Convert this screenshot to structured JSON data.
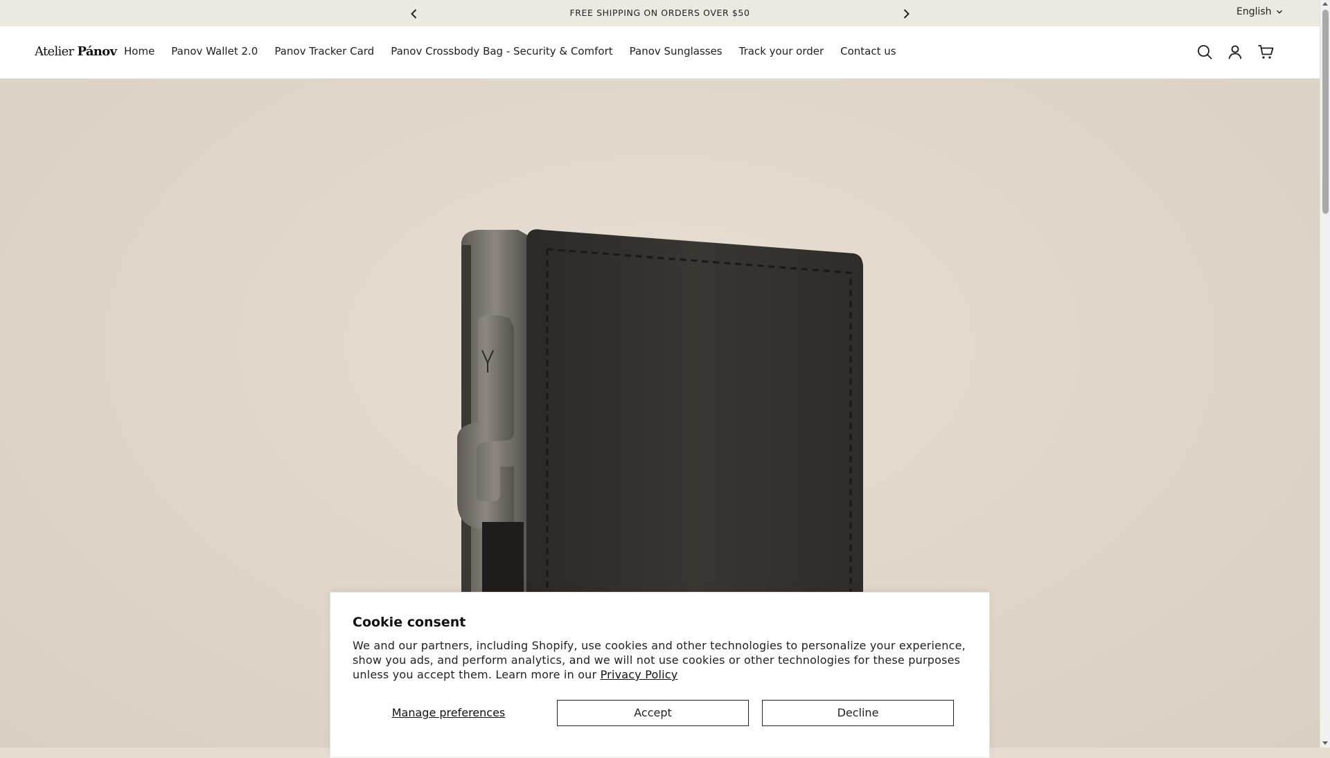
{
  "announcement": {
    "text": "FREE SHIPPING ON ORDERS OVER $50",
    "language": "English",
    "prev_icon": "chevron-left-icon",
    "next_icon": "chevron-right-icon"
  },
  "header": {
    "logo_light": "Atelier ",
    "logo_bold": "Pánov",
    "nav": [
      {
        "label": "Home"
      },
      {
        "label": "Panov Wallet 2.0"
      },
      {
        "label": "Panov Tracker Card"
      },
      {
        "label": "Panov Crossbody Bag - Security & Comfort"
      },
      {
        "label": "Panov Sunglasses"
      },
      {
        "label": "Track your order"
      },
      {
        "label": "Contact us"
      }
    ],
    "icons": [
      "search-icon",
      "account-icon",
      "cart-icon"
    ]
  },
  "cookie": {
    "title": "Cookie consent",
    "body": "We and our partners, including Shopify, use cookies and other technologies to personalize your experience, show you ads, and perform analytics, and we will not use cookies or other technologies for these purposes unless you accept them. Learn more in our ",
    "link": "Privacy Policy",
    "manage": "Manage preferences",
    "accept": "Accept",
    "decline": "Decline"
  },
  "colors": {
    "announcement_bg": "#ece9e3",
    "hero_bg": "#e0d6ca",
    "wallet_leather": "#2e2b28",
    "wallet_metal": "#6f6a64"
  }
}
